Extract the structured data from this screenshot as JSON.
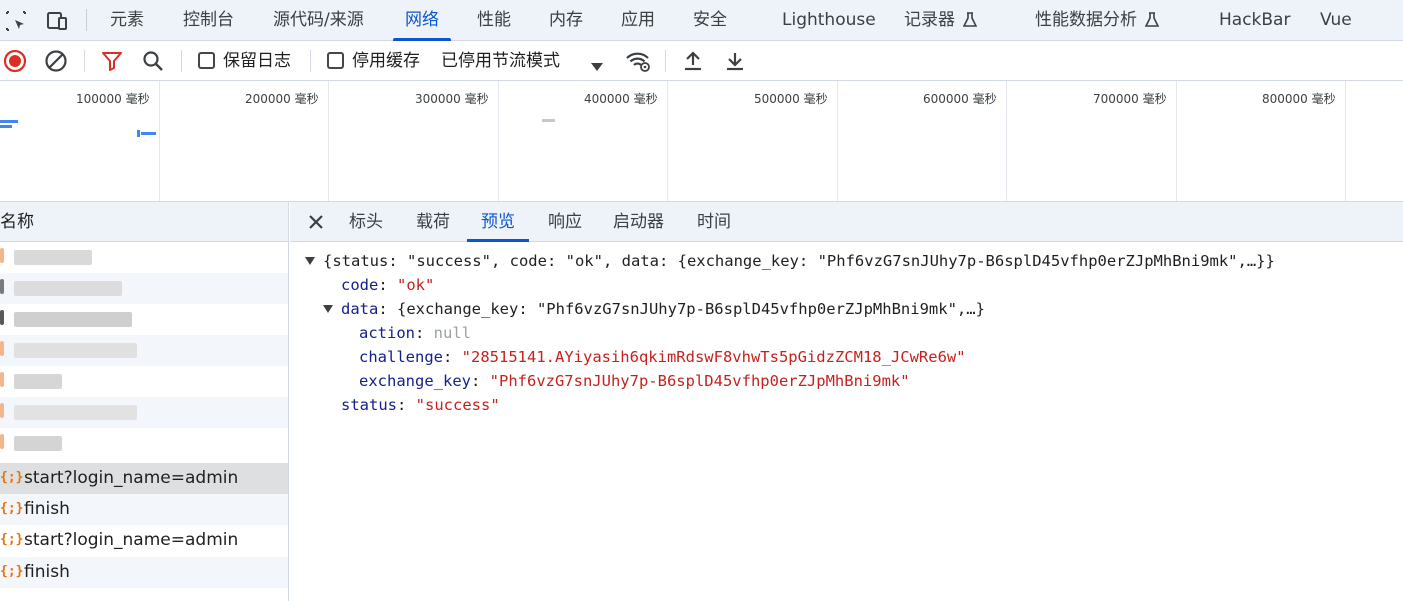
{
  "top_tabs": [
    "元素",
    "控制台",
    "源代码/来源",
    "网络",
    "性能",
    "内存",
    "应用",
    "安全",
    "Lighthouse",
    "记录器",
    "性能数据分析",
    "HackBar",
    "Vue"
  ],
  "active_top_tab": "网络",
  "toolbar": {
    "preserve_log_label": "保留日志",
    "disable_cache_label": "停用缓存",
    "throttling_value": "已停用节流模式"
  },
  "overview": {
    "ticks": [
      "100000 毫秒",
      "200000 毫秒",
      "300000 毫秒",
      "400000 毫秒",
      "500000 毫秒",
      "600000 毫秒",
      "700000 毫秒",
      "800000 毫秒"
    ]
  },
  "request_list": {
    "header": "名称",
    "rows": [
      {
        "name": "start?login_name=admin",
        "icon": "json-icon"
      },
      {
        "name": "finish",
        "icon": "json-icon"
      },
      {
        "name": "start?login_name=admin",
        "icon": "json-icon"
      },
      {
        "name": "finish",
        "icon": "json-icon"
      }
    ]
  },
  "detail": {
    "tabs": [
      "标头",
      "载荷",
      "预览",
      "响应",
      "启动器",
      "时间"
    ],
    "active_tab": "预览",
    "preview": {
      "summary": "{status: \"success\", code: \"ok\", data: {exchange_key: \"Phf6vzG7snJUhy7p-B6splD45vfhp0erZJpMhBni9mk\",…}}",
      "code_key": "code",
      "code_value": "\"ok\"",
      "data_key": "data",
      "data_summary": "{exchange_key: \"Phf6vzG7snJUhy7p-B6splD45vfhp0erZJpMhBni9mk\",…}",
      "action_key": "action",
      "action_value": "null",
      "challenge_key": "challenge",
      "challenge_value": "\"28515141.AYiyasih6qkimRdswF8vhwTs5pGidzZCM18_JCwRe6w\"",
      "exchange_key_key": "exchange_key",
      "exchange_key_value": "\"Phf6vzG7snJUhy7p-B6splD45vfhp0erZJpMhBni9mk\"",
      "status_key": "status",
      "status_value": "\"success\""
    }
  },
  "colors": {
    "accent": "#0b57d0",
    "record_red": "#d93025",
    "filter_red": "#d93025",
    "json_string": "#c5221f",
    "json_null": "#9aa0a6",
    "json_icon": "#e8710a"
  }
}
